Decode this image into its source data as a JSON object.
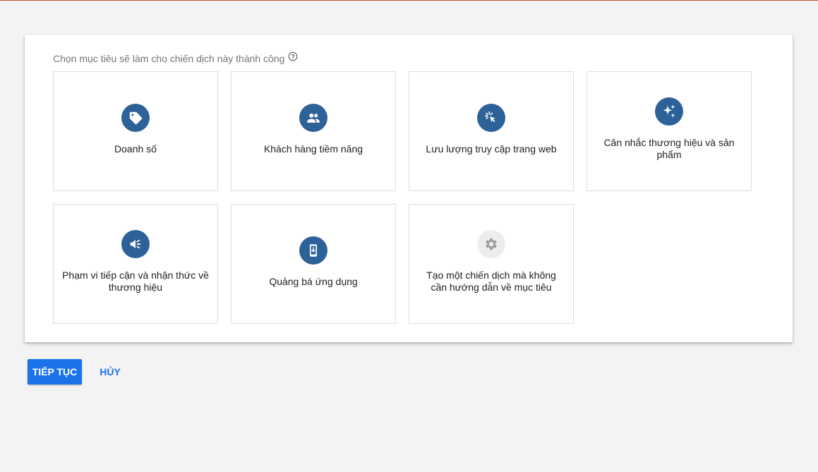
{
  "goal_selector": {
    "prompt": "Chọn mục tiêu sẽ làm cho chiến dịch này thành công",
    "help_icon": "help-circle-icon",
    "goals": [
      {
        "label": "Doanh số",
        "icon": "tag-icon"
      },
      {
        "label": "Khách hàng tiềm năng",
        "icon": "people-icon"
      },
      {
        "label": "Lưu lượng truy cập trang web",
        "icon": "cursor-click-icon"
      },
      {
        "label": "Cân nhắc thương hiệu và sản phẩm",
        "icon": "sparkle-icon"
      },
      {
        "label": "Phạm vi tiếp cận và nhận thức về thương hiệu",
        "icon": "megaphone-icon"
      },
      {
        "label": "Quảng bá ứng dụng",
        "icon": "phone-download-icon"
      },
      {
        "label": "Tạo một chiến dịch mà không cần hướng dẫn về mục tiêu",
        "icon": "gear-icon"
      }
    ]
  },
  "actions": {
    "continue_label": "TIẾP TỤC",
    "cancel_label": "HỦY"
  },
  "colors": {
    "accent": "#1a73e8",
    "icon_circle": "#2d6298",
    "icon_circle_disabled": "#ededed",
    "page_background": "#f3f3f3"
  }
}
